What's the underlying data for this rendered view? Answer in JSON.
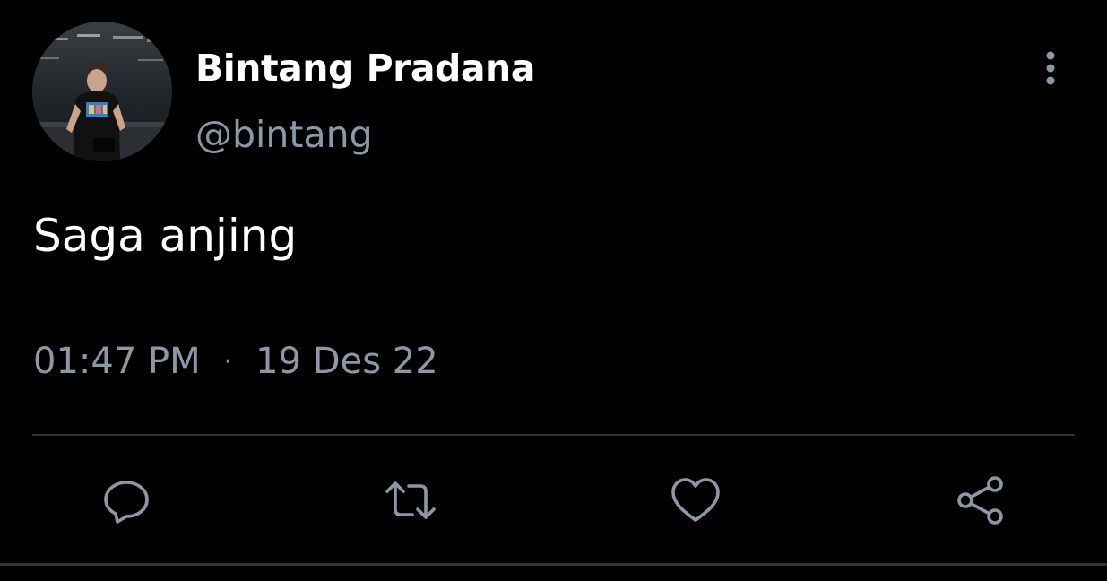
{
  "tweet": {
    "author": {
      "display_name": "Bintang Pradana",
      "handle": "@bintang"
    },
    "text": "Saga anjing",
    "time": "01:47 PM",
    "separator": "·",
    "date": "19 Des 22"
  },
  "actions": {
    "reply_icon": "reply-icon",
    "retweet_icon": "retweet-icon",
    "like_icon": "like-icon",
    "share_icon": "share-icon",
    "more_icon": "more-vertical-icon"
  },
  "colors": {
    "background": "#000000",
    "primary_text": "#ffffff",
    "secondary_text": "#8b98a5",
    "divider": "#2f3336"
  }
}
